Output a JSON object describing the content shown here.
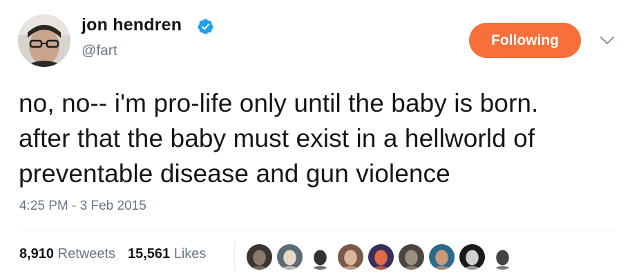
{
  "user": {
    "display_name": "jon hendren",
    "handle": "@fart",
    "verified_icon": "verified-badge-icon"
  },
  "follow_button": {
    "label": "Following",
    "color": "#f76f3a"
  },
  "menu_icon": "chevron-down-icon",
  "tweet": {
    "lines": [
      "no, no-- i'm pro-life only until the baby is born.",
      "after that the baby must exist in a hellworld of",
      "preventable disease and gun violence"
    ],
    "timestamp": "4:25 PM - 3 Feb 2015"
  },
  "stats": {
    "retweets_count": "8,910",
    "retweets_label": "Retweets",
    "likes_count": "15,561",
    "likes_label": "Likes"
  },
  "likers": [
    {
      "name": "liker-avatar-1",
      "bg": "#3b3430",
      "fg": "#8c7a6d"
    },
    {
      "name": "liker-avatar-2",
      "bg": "#5b6b78",
      "fg": "#e8d9c5"
    },
    {
      "name": "liker-avatar-3",
      "bg": "#ffffff",
      "fg": "#333333"
    },
    {
      "name": "liker-avatar-4",
      "bg": "#7a5a4a",
      "fg": "#d9b59a"
    },
    {
      "name": "liker-avatar-5",
      "bg": "#3a2f5a",
      "fg": "#e06a4a"
    },
    {
      "name": "liker-avatar-6",
      "bg": "#4a4540",
      "fg": "#9a8f80"
    },
    {
      "name": "liker-avatar-7",
      "bg": "#2a6a8a",
      "fg": "#c89a7a"
    },
    {
      "name": "liker-avatar-8",
      "bg": "#1a1a1a",
      "fg": "#d0d0d0"
    },
    {
      "name": "liker-avatar-9",
      "bg": "#ffffff",
      "fg": "#444444"
    }
  ]
}
